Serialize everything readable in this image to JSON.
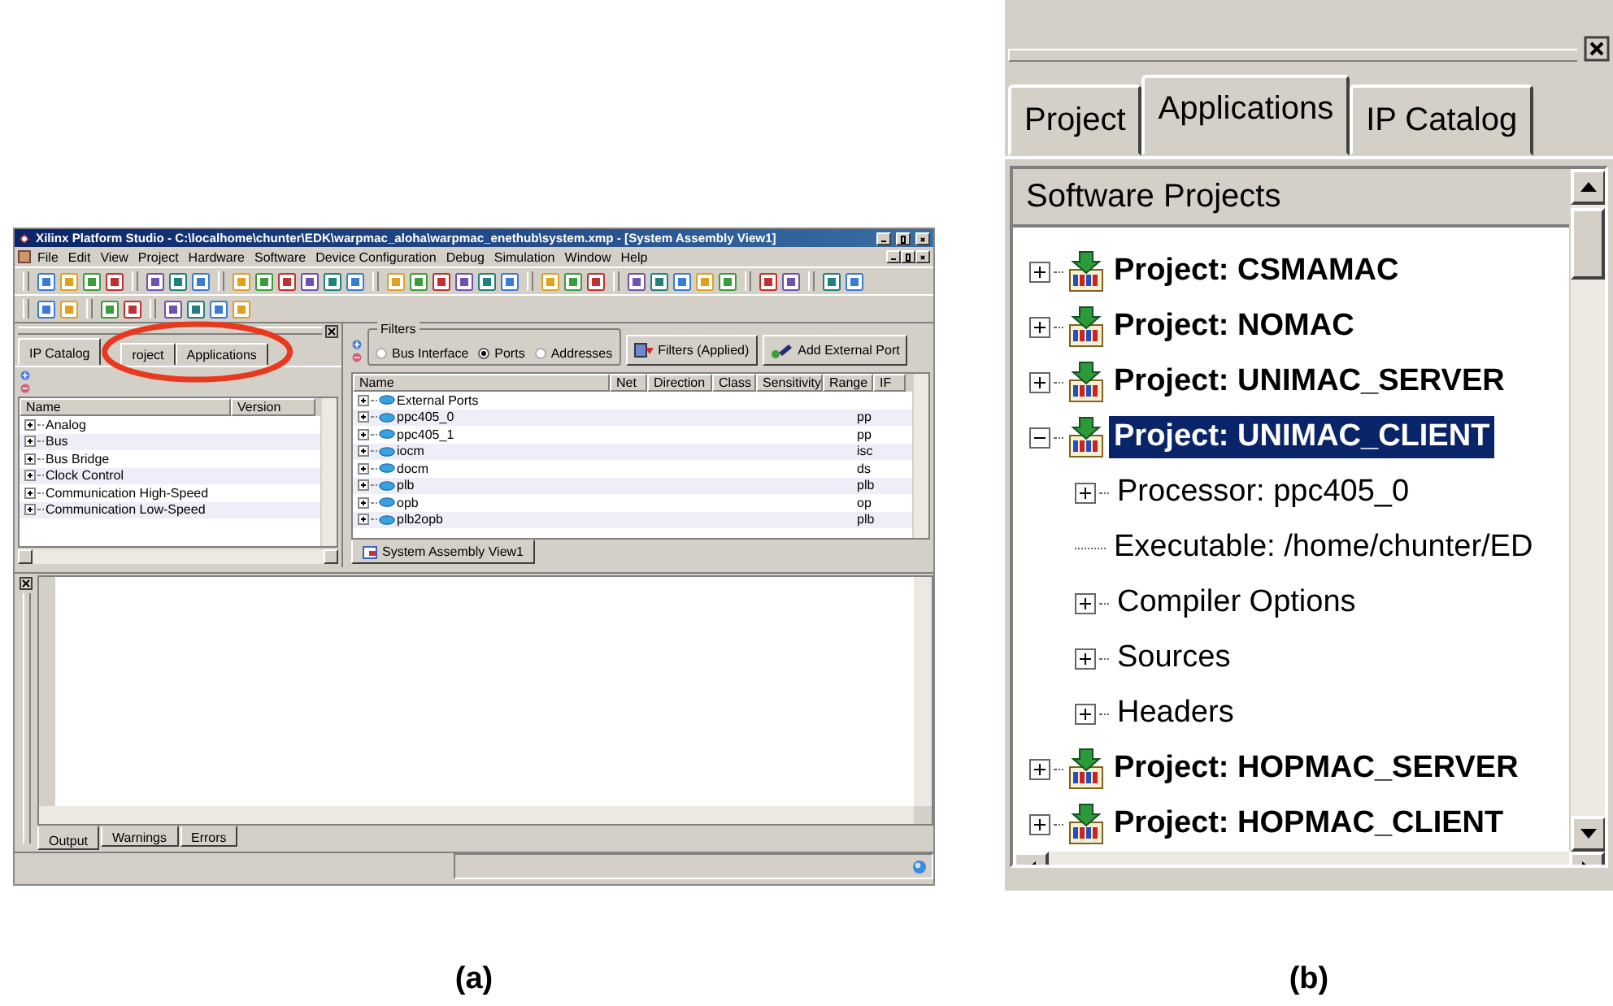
{
  "panel_a": {
    "window": {
      "title": "Xilinx Platform Studio - C:\\localhome\\chunter\\EDK\\warpmac_aloha\\warpmac_enethub\\system.xmp - [System Assembly View1]"
    },
    "menu": [
      "File",
      "Edit",
      "View",
      "Project",
      "Hardware",
      "Software",
      "Device Configuration",
      "Debug",
      "Simulation",
      "Window",
      "Help"
    ],
    "left_tabs": [
      {
        "label": "IP Catalog",
        "selected": true
      },
      {
        "label": "roject",
        "selected": false
      },
      {
        "label": "Applications",
        "selected": false
      }
    ],
    "ip_catalog": {
      "columns": [
        "Name",
        "Version"
      ],
      "rows": [
        {
          "label": "Analog",
          "expanded": false
        },
        {
          "label": "Bus",
          "expanded": false
        },
        {
          "label": "Bus Bridge",
          "expanded": false
        },
        {
          "label": "Clock Control",
          "expanded": false
        },
        {
          "label": "Communication High-Speed",
          "expanded": false
        },
        {
          "label": "Communication Low-Speed",
          "expanded": false
        }
      ]
    },
    "filters": {
      "title": "Filters",
      "options": [
        {
          "label": "Bus Interface",
          "selected": false
        },
        {
          "label": "Ports",
          "selected": true
        },
        {
          "label": "Addresses",
          "selected": false
        }
      ]
    },
    "buttons": [
      "Filters (Applied)",
      "Add External Port"
    ],
    "ports_table": {
      "columns": [
        "Name",
        "Net",
        "Direction",
        "Class",
        "Sensitivity",
        "Range",
        "IF"
      ],
      "rows": [
        {
          "name": "External Ports",
          "expanded": false
        },
        {
          "name": "ppc405_0",
          "expanded": false,
          "column_7": "pp"
        },
        {
          "name": "ppc405_1",
          "expanded": false,
          "column_7": "pp"
        },
        {
          "name": "iocm",
          "expanded": false,
          "column_7": "isc"
        },
        {
          "name": "docm",
          "expanded": false,
          "column_7": "ds"
        },
        {
          "name": "plb",
          "expanded": false,
          "column_7": "plb"
        },
        {
          "name": "opb",
          "expanded": false,
          "column_7": "op"
        },
        {
          "name": "plb2opb",
          "expanded": false,
          "column_7": "plb"
        }
      ]
    },
    "view_tab": "System Assembly View1",
    "output_tabs": [
      {
        "label": "Output",
        "selected": true
      },
      {
        "label": "Warnings",
        "selected": false
      },
      {
        "label": "Errors",
        "selected": false
      }
    ],
    "caption": "(a)"
  },
  "panel_b": {
    "tabs": [
      {
        "label": "Project",
        "selected": false
      },
      {
        "label": "Applications",
        "selected": true
      },
      {
        "label": "IP Catalog",
        "selected": false
      }
    ],
    "header": "Software Projects",
    "tree": [
      {
        "label": "Project: CSMAMAC",
        "expanded": false,
        "selected": false
      },
      {
        "label": "Project: NOMAC",
        "expanded": false,
        "selected": false
      },
      {
        "label": "Project: UNIMAC_SERVER",
        "expanded": false,
        "selected": false
      },
      {
        "label": "Project: UNIMAC_CLIENT",
        "expanded": true,
        "selected": true,
        "children": [
          {
            "label": "Processor: ppc405_0",
            "expanded": false
          },
          {
            "label": "Executable: /home/chunter/ED"
          },
          {
            "label": "Compiler Options",
            "expanded": false
          },
          {
            "label": "Sources",
            "expanded": false
          },
          {
            "label": "Headers",
            "expanded": false
          }
        ]
      },
      {
        "label": "Project: HOPMAC_SERVER",
        "expanded": false,
        "selected": false
      },
      {
        "label": "Project: HOPMAC_CLIENT",
        "expanded": false,
        "selected": false
      }
    ],
    "caption": "(b)"
  }
}
